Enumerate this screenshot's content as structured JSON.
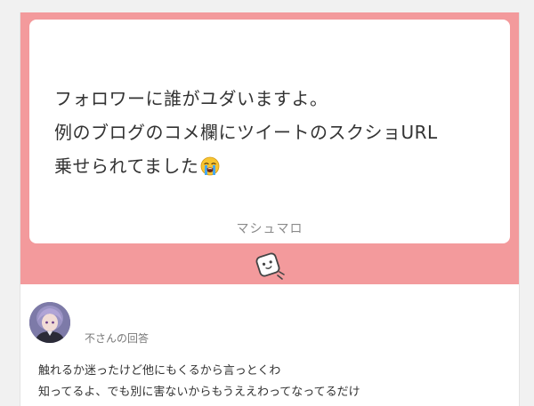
{
  "question": {
    "lines": [
      "フォロワーに誰がユダいますよ。",
      "例のブログのコメ欄にツイートのスクショURL",
      "乗せられてました"
    ],
    "emoji": "loudly-crying-face-emoji"
  },
  "brand": {
    "label": "マシュマロ",
    "logo_icon": "marshmallow-logo-icon"
  },
  "answer": {
    "answerer_label": "不さんの回答",
    "lines": [
      "触れるか迷ったけど他にもくるから言っとくわ",
      "知ってるよ、でも別に害ないからもうええわってなってるだけ"
    ]
  },
  "colors": {
    "accent": "#f39a9c",
    "page_background": "#f1f1f1",
    "card": "#ffffff"
  }
}
